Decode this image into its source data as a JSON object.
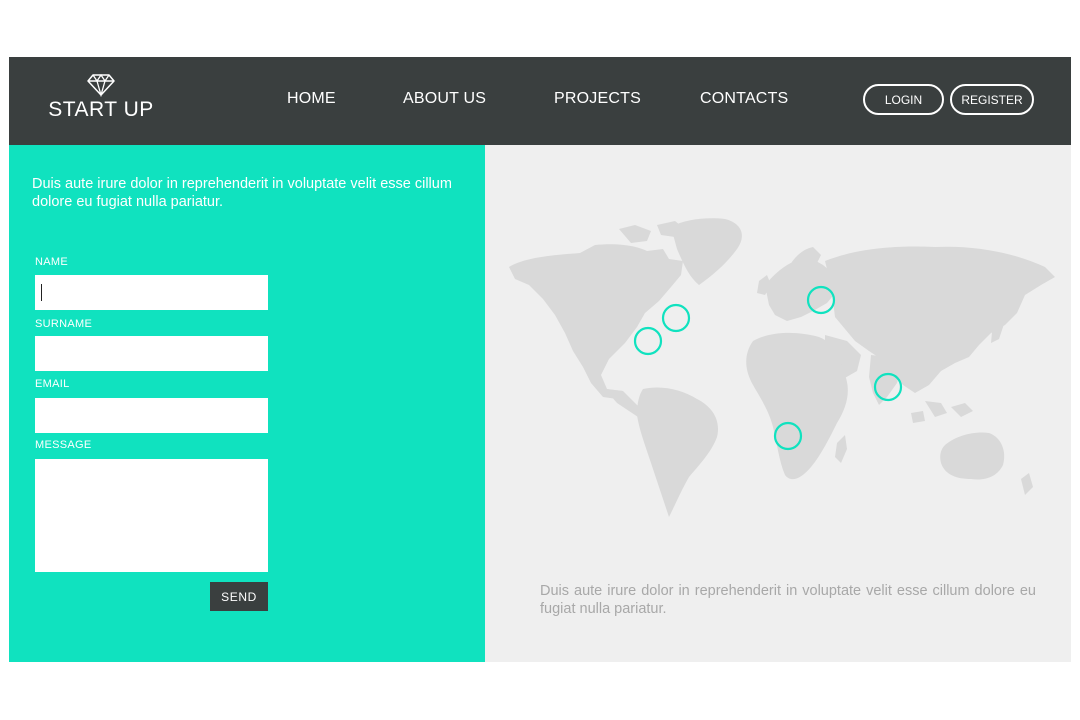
{
  "header": {
    "brand": "START UP",
    "nav": [
      "HOME",
      "ABOUT US",
      "PROJECTS",
      "CONTACTS"
    ],
    "login_label": "LOGIN",
    "register_label": "REGISTER"
  },
  "form": {
    "intro": "Duis aute irure dolor in reprehenderit in voluptate velit esse cillum dolore eu fugiat nulla pariatur.",
    "name_label": "NAME",
    "name_value": "",
    "surname_label": "SURNAME",
    "surname_value": "",
    "email_label": "EMAIL",
    "email_value": "",
    "message_label": "MESSAGE",
    "message_value": "",
    "send_label": "SEND"
  },
  "map_panel": {
    "caption": "Duis aute irure dolor in reprehenderit in voluptate velit esse cillum dolore eu fugiat nulla pariatur.",
    "markers": [
      "north-america-east",
      "north-america-coast",
      "europe",
      "india",
      "southern-africa"
    ]
  },
  "colors": {
    "header_bg": "#3a3f3f",
    "accent": "#10e2bf",
    "map_land": "#d9d9d9",
    "panel_bg": "#efefef"
  }
}
